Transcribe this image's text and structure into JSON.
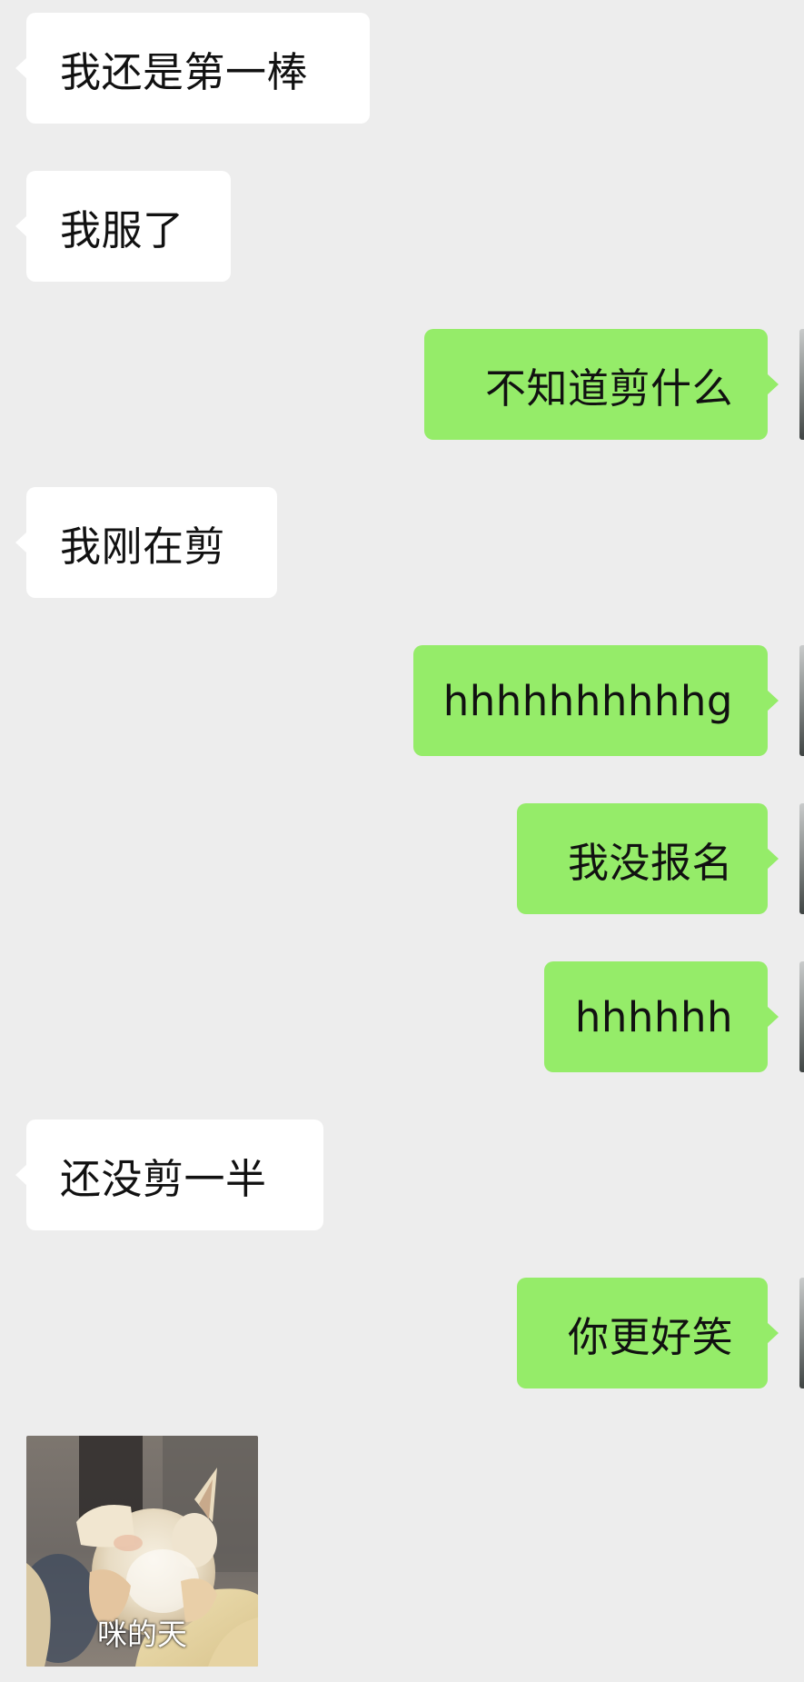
{
  "messages": [
    {
      "side": "in",
      "text": "我还是第一棒"
    },
    {
      "side": "in",
      "text": "我服了"
    },
    {
      "side": "out",
      "text": "不知道剪什么"
    },
    {
      "side": "in",
      "text": "我刚在剪"
    },
    {
      "side": "out",
      "text": "hhhhhhhhhhg"
    },
    {
      "side": "out",
      "text": "我没报名"
    },
    {
      "side": "out",
      "text": "hhhhhh"
    },
    {
      "side": "in",
      "text": "还没剪一半"
    },
    {
      "side": "out",
      "text": "你更好笑"
    }
  ],
  "sticker": {
    "caption": "咪的天",
    "depicts": "cat-sticker"
  },
  "colors": {
    "background": "#ededed",
    "incoming_bubble": "#ffffff",
    "outgoing_bubble": "#95ec69",
    "text": "#111111"
  }
}
